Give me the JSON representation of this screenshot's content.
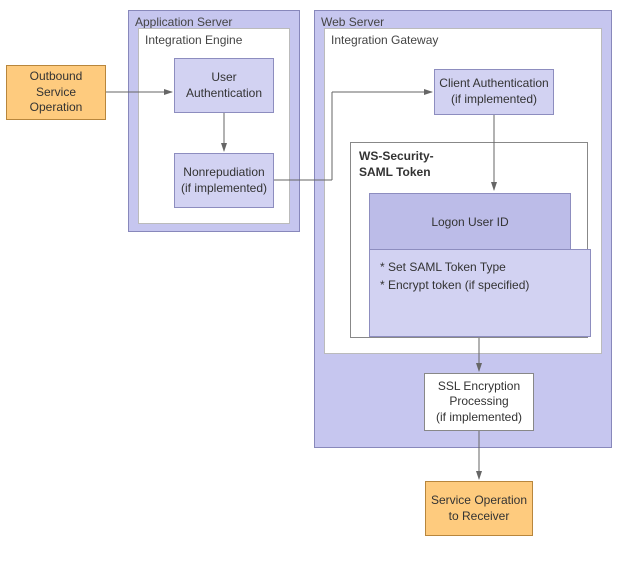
{
  "labels": {
    "application_server": "Application Server",
    "web_server": "Web Server",
    "integration_engine": "Integration Engine",
    "integration_gateway": "Integration Gateway"
  },
  "nodes": {
    "outbound": "Outbound Service Operation",
    "user_auth": "User Authentication",
    "nonrepudiation_l1": "Nonrepudiation",
    "nonrepudiation_l2": "(if implemented)",
    "client_auth_l1": "Client Authentication",
    "client_auth_l2": "(if implemented)",
    "ssl_l1": "SSL Encryption Processing",
    "ssl_l2": "(if implemented)",
    "receiver": "Service Operation to Receiver"
  },
  "ws_security": {
    "title_l1": "WS-Security-",
    "title_l2": "SAML Token",
    "logon": "Logon User ID",
    "note1": "* Set SAML Token Type",
    "note2": "* Encrypt token (if specified)"
  }
}
